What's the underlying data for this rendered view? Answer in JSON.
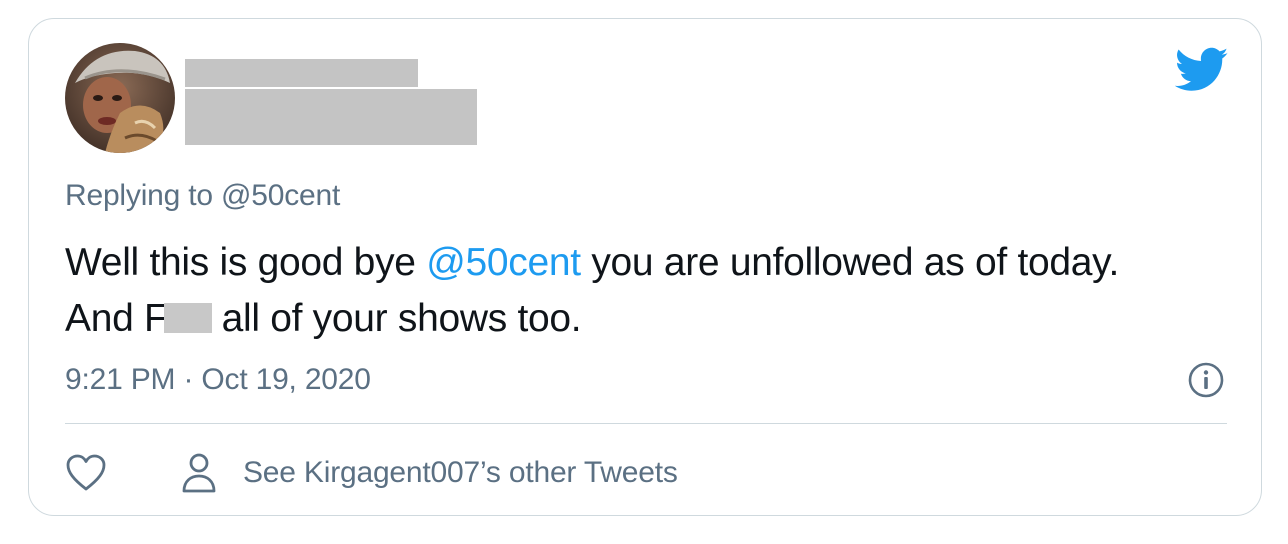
{
  "tweet": {
    "replying_prefix": "Replying to ",
    "replying_handle": "@50cent",
    "text_part1": "Well this is good bye ",
    "mention": "@50cent",
    "text_part2": " you are unfollowed as of today. And F",
    "text_part3": "all of your shows too.",
    "timestamp": "9:21 PM · Oct 19, 2020"
  },
  "actions": {
    "other_tweets_label": "See Kirgagent007’s other Tweets"
  },
  "icons": {
    "brand": "twitter-bird-icon",
    "info": "info-icon",
    "like": "heart-icon",
    "profile": "person-icon"
  },
  "colors": {
    "brand_blue": "#1d9bf0",
    "secondary_text": "#5b7083",
    "primary_text": "#0f1419",
    "border": "#cfd9de",
    "redaction": "#c4c4c4"
  }
}
